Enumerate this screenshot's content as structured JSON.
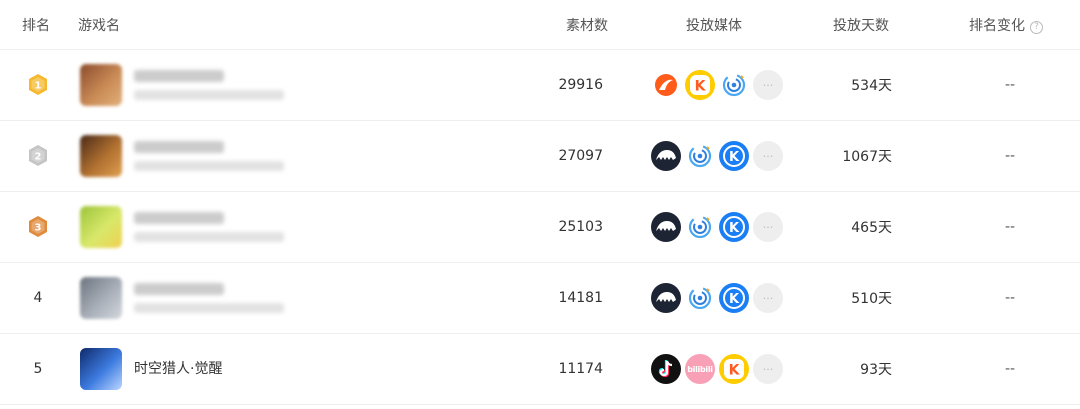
{
  "header": {
    "rank": "排名",
    "game": "游戏名",
    "materials": "素材数",
    "media": "投放媒体",
    "days": "投放天数",
    "rank_change": "排名变化",
    "help_glyph": "?"
  },
  "rows": [
    {
      "rank": "1",
      "rank_style": "gold-medal",
      "game_name": "",
      "name_blurred": true,
      "thumb_colors": [
        "#8a4a2c",
        "#c98a55",
        "#e2b07a"
      ],
      "materials": "29916",
      "media_icons": [
        "toutiao-orange-icon",
        "kuaishou-yellow-icon",
        "swirl-app-icon",
        "more-icon"
      ],
      "days": "534天",
      "rank_change": "--"
    },
    {
      "rank": "2",
      "rank_style": "silver-medal",
      "game_name": "",
      "name_blurred": true,
      "thumb_colors": [
        "#4a2a18",
        "#b07030",
        "#e0a050"
      ],
      "materials": "27097",
      "media_icons": [
        "pangolin-icon",
        "swirl-app-icon",
        "kuaishou-blue-icon",
        "more-icon"
      ],
      "days": "1067天",
      "rank_change": "--"
    },
    {
      "rank": "3",
      "rank_style": "bronze-medal",
      "game_name": "",
      "name_blurred": true,
      "thumb_colors": [
        "#9cc43a",
        "#d8e86a",
        "#f0d050"
      ],
      "materials": "25103",
      "media_icons": [
        "pangolin-icon",
        "swirl-app-icon",
        "kuaishou-blue-icon",
        "more-icon"
      ],
      "days": "465天",
      "rank_change": "--"
    },
    {
      "rank": "4",
      "rank_style": "plain",
      "game_name": "",
      "name_blurred": true,
      "thumb_colors": [
        "#6c7480",
        "#a8afb8",
        "#d4d8de"
      ],
      "materials": "14181",
      "media_icons": [
        "pangolin-icon",
        "swirl-app-icon",
        "kuaishou-blue-icon",
        "more-icon"
      ],
      "days": "510天",
      "rank_change": "--"
    },
    {
      "rank": "5",
      "rank_style": "plain",
      "game_name": "时空猎人·觉醒",
      "name_blurred": false,
      "thumb_colors": [
        "#0e2a6a",
        "#3d7be0",
        "#bcd6ff"
      ],
      "materials": "11174",
      "media_icons": [
        "tiktok-icon",
        "bilibili-icon",
        "kuaishou-yellow-icon",
        "more-icon"
      ],
      "days": "93天",
      "rank_change": "--"
    }
  ],
  "media_labels": {
    "bilibili": "bilibili",
    "kuaishou_letter": "K",
    "more": "···"
  },
  "colors": {
    "gold": "#f5b82e",
    "silver": "#c5c5c5",
    "bronze": "#e08a3c",
    "kuaishou_blue": "#1a7ef5",
    "kuaishou_yellow": "#ffcc00",
    "kuaishou_orange": "#ff5a1f",
    "toutiao": "#ff5b1a",
    "pangolin_bg": "#1d2433",
    "tiktok_bg": "#111111",
    "bilibili_bg": "#f7a0b6",
    "more_bg": "#eeeeee"
  }
}
